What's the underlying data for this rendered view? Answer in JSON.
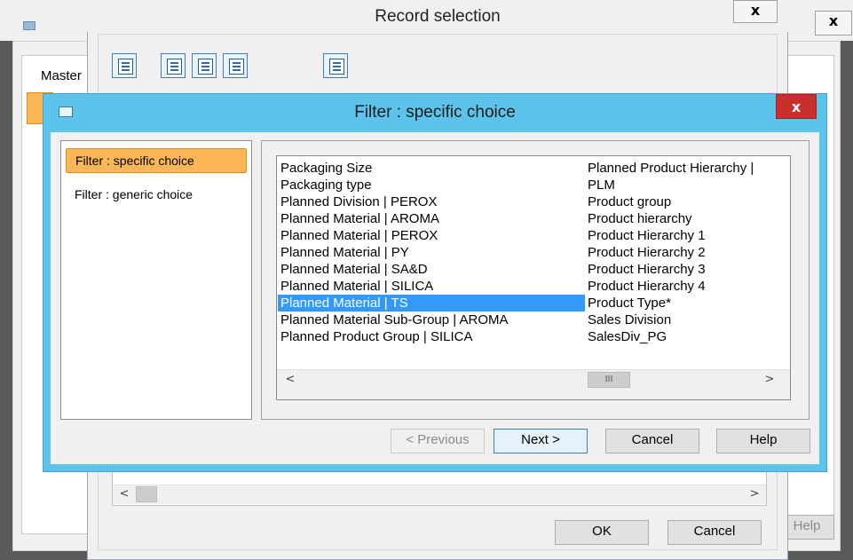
{
  "back_window": {
    "tab_label": "Master",
    "close_label": "x",
    "help_label": "Help"
  },
  "record_selection": {
    "title": "Record selection",
    "close_label": "x",
    "ok_label": "OK",
    "cancel_label": "Cancel"
  },
  "filter_dialog": {
    "title": "Filter : specific choice",
    "close_label": "x",
    "nav": [
      "Filter : specific choice",
      "Filter : generic choice"
    ],
    "list_col1": [
      "Packaging Size",
      "Packaging type",
      "Planned Division | PEROX",
      "Planned Material | AROMA",
      "Planned Material | PEROX",
      "Planned Material | PY",
      "Planned Material | SA&D",
      "Planned Material | SILICA",
      "Planned Material | TS",
      "Planned Material Sub-Group | AROMA",
      "Planned Product Group | SILICA"
    ],
    "list_col2": [
      "Planned Product Hierarchy |",
      "PLM",
      "Product group",
      "Product hierarchy",
      "Product Hierarchy 1",
      "Product Hierarchy 2",
      "Product Hierarchy 3",
      "Product Hierarchy 4",
      "Product Type*",
      "Sales Division",
      "SalesDiv_PG"
    ],
    "selected_item": "Planned Material | TS",
    "scroll_left": "<",
    "scroll_right": ">",
    "scroll_thumb": "III",
    "buttons": {
      "previous": "< Previous",
      "next": "Next >",
      "cancel": "Cancel",
      "help": "Help"
    }
  },
  "colors": {
    "accent": "#5dc3ea",
    "selection": "#3399ff",
    "nav_selected": "#fbb755",
    "close_red": "#c9302c"
  }
}
